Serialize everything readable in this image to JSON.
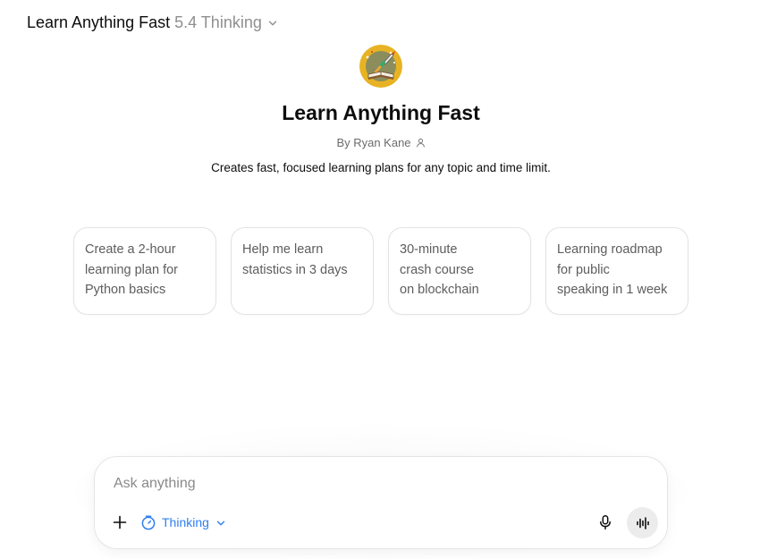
{
  "header": {
    "model_name": "Learn Anything Fast",
    "model_version": "5.4 Thinking",
    "dropdown_icon": "chevron-down-icon"
  },
  "gpt": {
    "title": "Learn Anything Fast",
    "byline": "By Ryan Kane",
    "byline_icon": "person-icon",
    "description": "Creates fast, focused learning plans for any topic and time limit.",
    "avatar": "rocket-book-avatar"
  },
  "starters": [
    {
      "label": "Create a 2-hour\nlearning plan for\nPython basics"
    },
    {
      "label": "Help me learn\nstatistics in 3 days"
    },
    {
      "label": "30-minute\ncrash course\non blockchain"
    },
    {
      "label": "Learning roadmap\nfor public\nspeaking in 1 week"
    }
  ],
  "composer": {
    "placeholder": "Ask anything",
    "value": "",
    "mode_label": "Thinking",
    "mode_icon": "timer-icon",
    "icons": [
      "plus-icon",
      "microphone-icon",
      "voice-waveform-icon"
    ]
  },
  "colors": {
    "accent": "#2f7ff0",
    "text": "#0d0d0d",
    "muted": "#8f8f8f",
    "card_border": "#e3e3e3",
    "voice_button_bg": "#ececec"
  }
}
